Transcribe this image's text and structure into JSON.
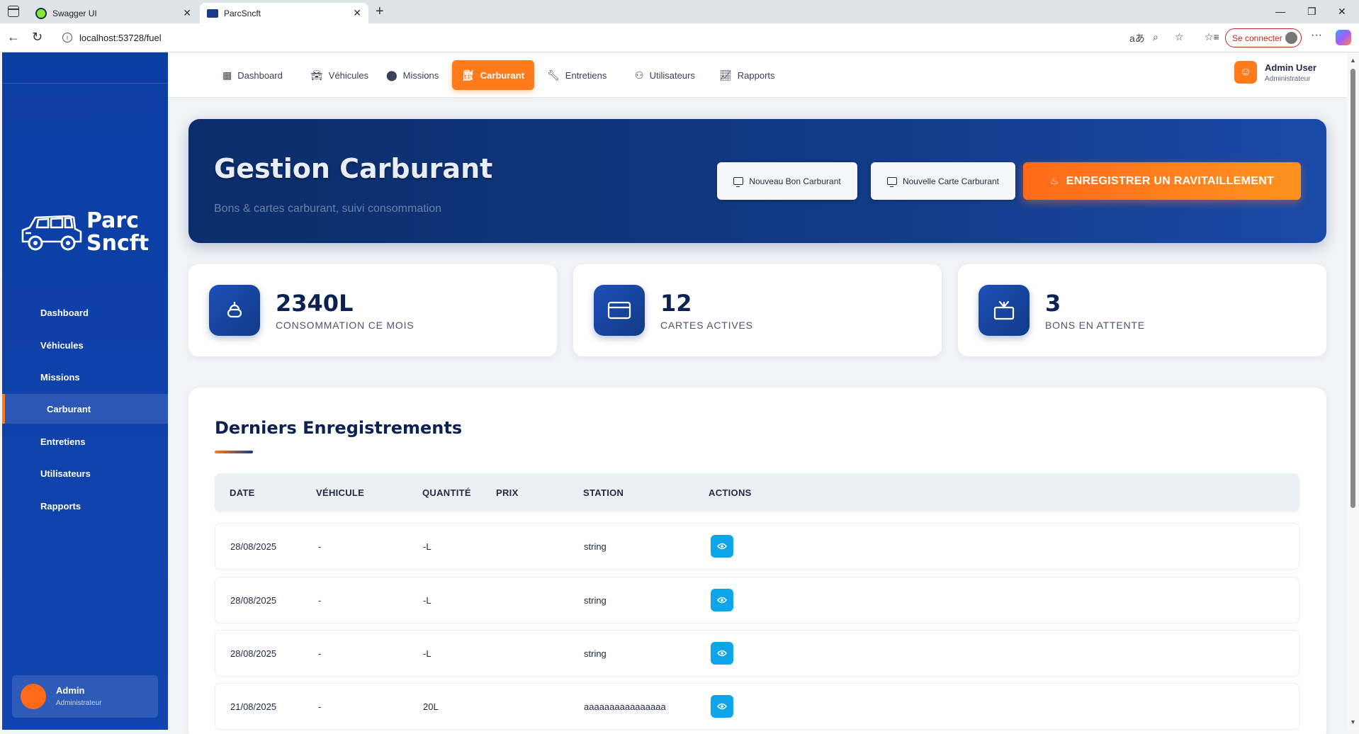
{
  "browser": {
    "tabs": [
      {
        "label": "Swagger UI"
      },
      {
        "label": "ParcSncft"
      }
    ],
    "url": "localhost:53728/fuel",
    "connect_label": "Se connecter"
  },
  "sidebar": {
    "logo_line1": "Parc",
    "logo_line2": "Sncft",
    "items": [
      {
        "label": "Dashboard"
      },
      {
        "label": "Véhicules"
      },
      {
        "label": "Missions"
      },
      {
        "label": "Carburant"
      },
      {
        "label": "Entretiens"
      },
      {
        "label": "Utilisateurs"
      },
      {
        "label": "Rapports"
      }
    ],
    "user": {
      "name": "Admin",
      "role": "Administrateur"
    }
  },
  "topnav": {
    "items": [
      {
        "label": "Dashboard",
        "icon": "dashboard-icon"
      },
      {
        "label": "Véhicules",
        "icon": "car-icon"
      },
      {
        "label": "Missions",
        "icon": "map-pin-icon"
      },
      {
        "label": "Carburant",
        "icon": "fuel-icon"
      },
      {
        "label": "Entretiens",
        "icon": "wrench-icon"
      },
      {
        "label": "Utilisateurs",
        "icon": "users-icon"
      },
      {
        "label": "Rapports",
        "icon": "chart-line-icon"
      }
    ],
    "user": {
      "name": "Admin User",
      "role": "Administrateur"
    }
  },
  "hero": {
    "title": "Gestion Carburant",
    "subtitle": "Bons & cartes carburant, suivi consommation",
    "btn_bon": "Nouveau Bon Carburant",
    "btn_carte": "Nouvelle Carte Carburant",
    "btn_ravitaillement": "ENREGISTRER UN RAVITAILLEMENT"
  },
  "stats": [
    {
      "value": "2340L",
      "label": "CONSOMMATION CE MOIS",
      "icon": "fuel-drop-icon"
    },
    {
      "value": "12",
      "label": "CARTES ACTIVES",
      "icon": "credit-card-icon"
    },
    {
      "value": "3",
      "label": "BONS EN ATTENTE",
      "icon": "inbox-icon"
    }
  ],
  "table": {
    "title": "Derniers Enregistrements",
    "columns": [
      "DATE",
      "VÉHICULE",
      "QUANTITÉ",
      "PRIX",
      "STATION",
      "ACTIONS"
    ],
    "rows": [
      {
        "date": "28/08/2025",
        "vehicule": "-",
        "quantite": "-L",
        "prix": "",
        "station": "string"
      },
      {
        "date": "28/08/2025",
        "vehicule": "-",
        "quantite": "-L",
        "prix": "",
        "station": "string"
      },
      {
        "date": "28/08/2025",
        "vehicule": "-",
        "quantite": "-L",
        "prix": "",
        "station": "string"
      },
      {
        "date": "21/08/2025",
        "vehicule": "-",
        "quantite": "20L",
        "prix": "",
        "station": "aaaaaaaaaaaaaaaa"
      }
    ]
  },
  "colors": {
    "primary_blue": "#0b3ea3",
    "accent_orange": "#ff7a1a",
    "action_blue": "#0ea5e9"
  }
}
